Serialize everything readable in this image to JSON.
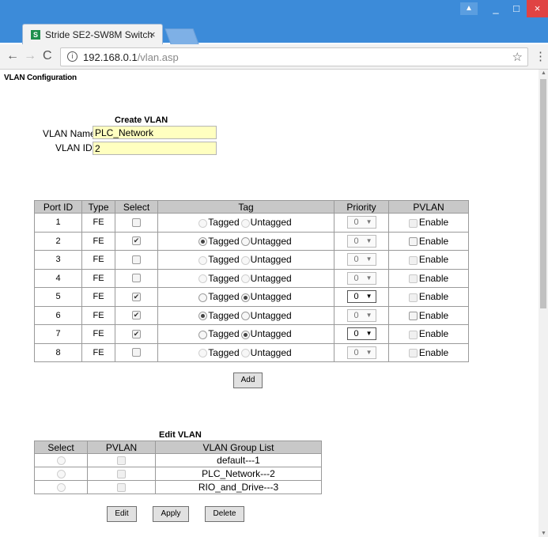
{
  "browser": {
    "tab_title": "Stride SE2-SW8M Switch",
    "tab_close": "×",
    "favicon": "S",
    "url_host": "192.168.0.1",
    "url_path": "/vlan.asp",
    "back": "←",
    "forward": "→",
    "reload": "C",
    "star": "☆",
    "menu": "⋮",
    "window_min": "_",
    "window_max": "□",
    "window_close": "×",
    "user_icon": "user-icon"
  },
  "page": {
    "title": "VLAN Configuration"
  },
  "create_vlan": {
    "title": "Create VLAN",
    "name_label": "VLAN Name:",
    "name_value": "PLC_Network",
    "id_label": "VLAN ID :",
    "id_value": "2"
  },
  "port_table": {
    "headers": [
      "Port ID",
      "Type",
      "Select",
      "Tag",
      "Priority",
      "PVLAN"
    ],
    "tagged_label": "Tagged",
    "untagged_label": "Untagged",
    "enable_label": "Enable",
    "rows": [
      {
        "port": "1",
        "type": "FE",
        "selected": false,
        "tag": "none",
        "priority": "0",
        "pvlan": false
      },
      {
        "port": "2",
        "type": "FE",
        "selected": true,
        "tag": "tagged",
        "priority": "0",
        "pvlan": false
      },
      {
        "port": "3",
        "type": "FE",
        "selected": false,
        "tag": "none",
        "priority": "0",
        "pvlan": false
      },
      {
        "port": "4",
        "type": "FE",
        "selected": false,
        "tag": "none",
        "priority": "0",
        "pvlan": false
      },
      {
        "port": "5",
        "type": "FE",
        "selected": true,
        "tag": "untagged",
        "priority": "0",
        "pvlan": false
      },
      {
        "port": "6",
        "type": "FE",
        "selected": true,
        "tag": "tagged",
        "priority": "0",
        "pvlan": false
      },
      {
        "port": "7",
        "type": "FE",
        "selected": true,
        "tag": "untagged",
        "priority": "0",
        "pvlan": false
      },
      {
        "port": "8",
        "type": "FE",
        "selected": false,
        "tag": "none",
        "priority": "0",
        "pvlan": false
      }
    ]
  },
  "add_button": "Add",
  "edit_vlan": {
    "title": "Edit VLAN",
    "headers": [
      "Select",
      "PVLAN",
      "VLAN Group List"
    ],
    "rows": [
      {
        "group": "default---1"
      },
      {
        "group": "PLC_Network---2"
      },
      {
        "group": "RIO_and_Drive---3"
      }
    ]
  },
  "buttons": {
    "edit": "Edit",
    "apply": "Apply",
    "delete": "Delete"
  }
}
